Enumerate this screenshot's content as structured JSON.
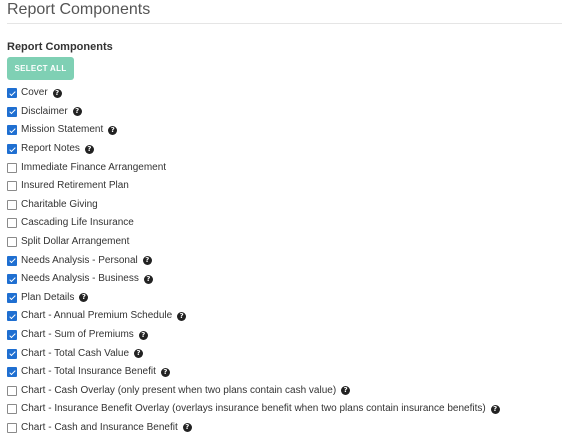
{
  "page": {
    "title": "Report Components"
  },
  "section": {
    "label": "Report Components",
    "select_all_label": "SELECT ALL"
  },
  "components": [
    {
      "label": "Cover",
      "checked": true,
      "help": true
    },
    {
      "label": "Disclaimer",
      "checked": true,
      "help": true
    },
    {
      "label": "Mission Statement",
      "checked": true,
      "help": true
    },
    {
      "label": "Report Notes",
      "checked": true,
      "help": true
    },
    {
      "label": "Immediate Finance Arrangement",
      "checked": false,
      "help": false
    },
    {
      "label": "Insured Retirement Plan",
      "checked": false,
      "help": false
    },
    {
      "label": "Charitable Giving",
      "checked": false,
      "help": false
    },
    {
      "label": "Cascading Life Insurance",
      "checked": false,
      "help": false
    },
    {
      "label": "Split Dollar Arrangement",
      "checked": false,
      "help": false
    },
    {
      "label": "Needs Analysis - Personal",
      "checked": true,
      "help": true
    },
    {
      "label": "Needs Analysis - Business",
      "checked": true,
      "help": true
    },
    {
      "label": "Plan Details",
      "checked": true,
      "help": true
    },
    {
      "label": "Chart - Annual Premium Schedule",
      "checked": true,
      "help": true
    },
    {
      "label": "Chart - Sum of Premiums",
      "checked": true,
      "help": true
    },
    {
      "label": "Chart - Total Cash Value",
      "checked": true,
      "help": true
    },
    {
      "label": "Chart - Total Insurance Benefit",
      "checked": true,
      "help": true
    },
    {
      "label": "Chart - Cash Overlay (only present when two plans contain cash value)",
      "checked": false,
      "help": true
    },
    {
      "label": "Chart - Insurance Benefit Overlay (overlays insurance benefit when two plans contain insurance benefits)",
      "checked": false,
      "help": true
    },
    {
      "label": "Chart - Cash and Insurance Benefit",
      "checked": false,
      "help": true
    }
  ],
  "icons": {
    "help": "question-circle-icon",
    "help_glyph": "?"
  },
  "colors": {
    "select_all_bg": "#7fd0b4",
    "checkbox_checked": "#1f6fd1"
  }
}
